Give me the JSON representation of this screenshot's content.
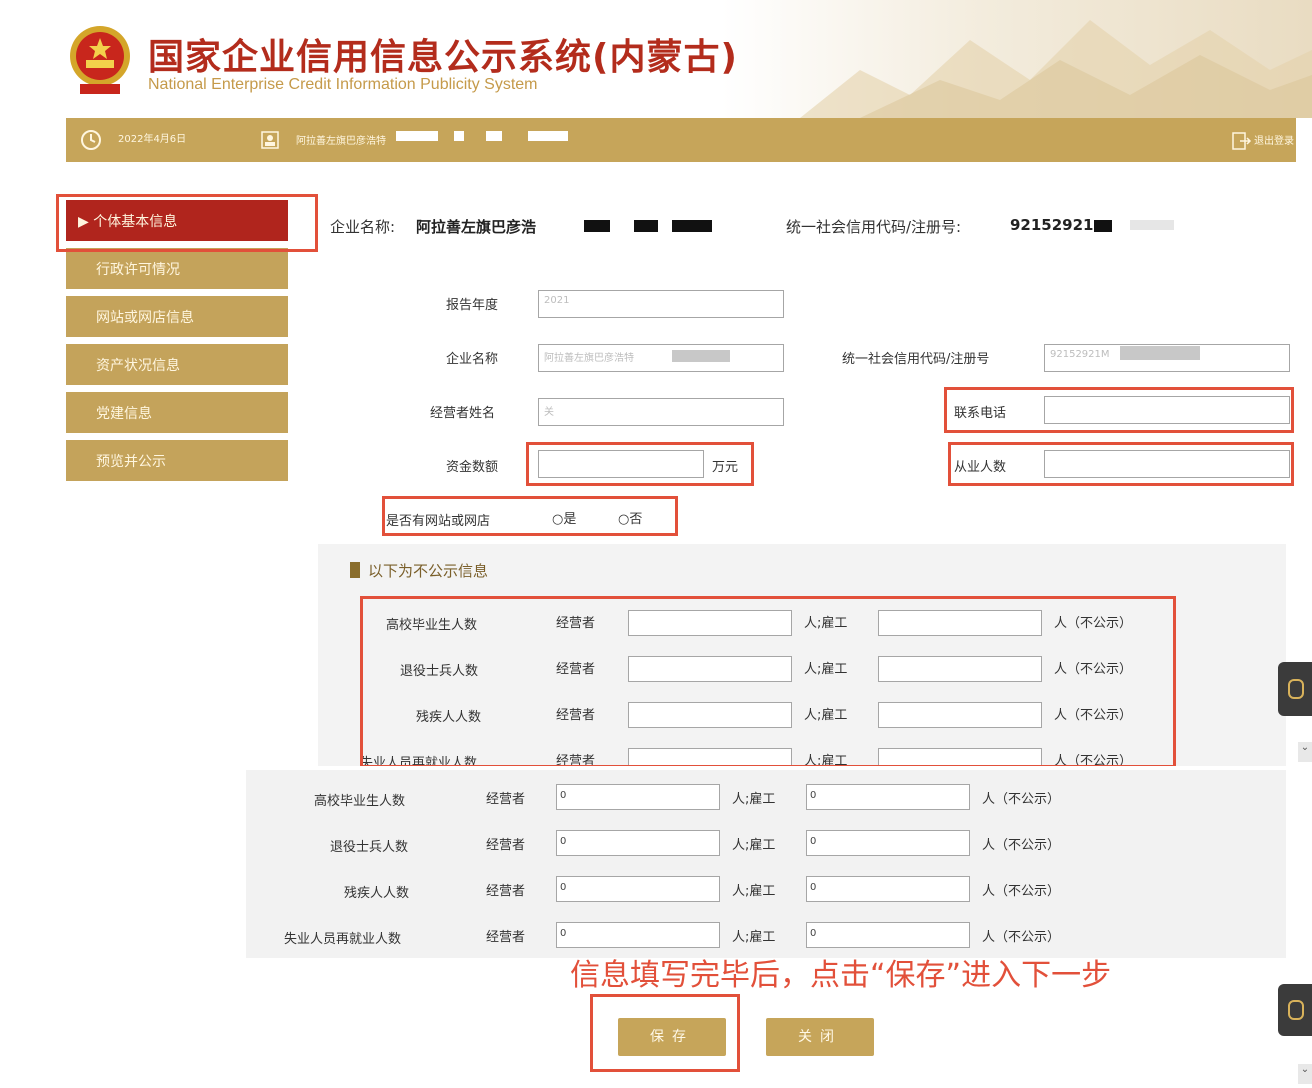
{
  "header": {
    "title": "国家企业信用信息公示系统(内蒙古)",
    "subtitle": "National Enterprise Credit Information Publicity System"
  },
  "infobar": {
    "date": "2022年4月6日",
    "user": "阿拉善左旗巴彦浩特",
    "logout": "退出登录"
  },
  "sidebar": {
    "items": [
      {
        "label": "个体基本信息",
        "active": true
      },
      {
        "label": "行政许可情况"
      },
      {
        "label": "网站或网店信息"
      },
      {
        "label": "资产状况信息"
      },
      {
        "label": "党建信息"
      },
      {
        "label": "预览并公示"
      }
    ]
  },
  "top_info": {
    "enterprise_name_label": "企业名称:",
    "enterprise_name_value": "阿拉善左旗巴彦浩",
    "credit_code_label": "统一社会信用代码/注册号:",
    "credit_code_value": "92152921"
  },
  "form": {
    "report_year_label": "报告年度",
    "report_year_value": "2021",
    "enterprise_name_label": "企业名称",
    "enterprise_name_value": "阿拉善左旗巴彦浩特",
    "credit_code_label": "统一社会信用代码/注册号",
    "credit_code_value": "92152921M",
    "operator_name_label": "经营者姓名",
    "operator_name_value": "关",
    "phone_label": "联系电话",
    "capital_label": "资金数额",
    "capital_unit": "万元",
    "employees_label": "从业人数",
    "website_question": "是否有网站或网店",
    "yes_label": "是",
    "no_label": "否"
  },
  "nonpublic": {
    "section_title": "以下为不公示信息",
    "operator_label": "经营者",
    "employee_prefix": "人;雇工",
    "suffix": "人（不公示）",
    "rows": [
      {
        "label": "高校毕业生人数"
      },
      {
        "label": "退役士兵人数"
      },
      {
        "label": "残疾人人数"
      },
      {
        "label": "失业人员再就业人数"
      }
    ]
  },
  "lower": {
    "rows": [
      {
        "label": "高校毕业生人数",
        "operator_value": "0",
        "employee_value": "0"
      },
      {
        "label": "退役士兵人数",
        "operator_value": "0",
        "employee_value": "0"
      },
      {
        "label": "残疾人人数",
        "operator_value": "0",
        "employee_value": "0"
      },
      {
        "label": "失业人员再就业人数",
        "operator_value": "0",
        "employee_value": "0"
      }
    ],
    "operator_label": "经营者",
    "employee_prefix": "人;雇工",
    "suffix": "人（不公示）"
  },
  "annotation": "信息填写完毕后，点击“保存”进入下一步",
  "buttons": {
    "save": "保存",
    "close": "关闭"
  },
  "colors": {
    "gold": "#c6a55a",
    "red": "#b0251d",
    "annotation_red": "#e2503a"
  }
}
